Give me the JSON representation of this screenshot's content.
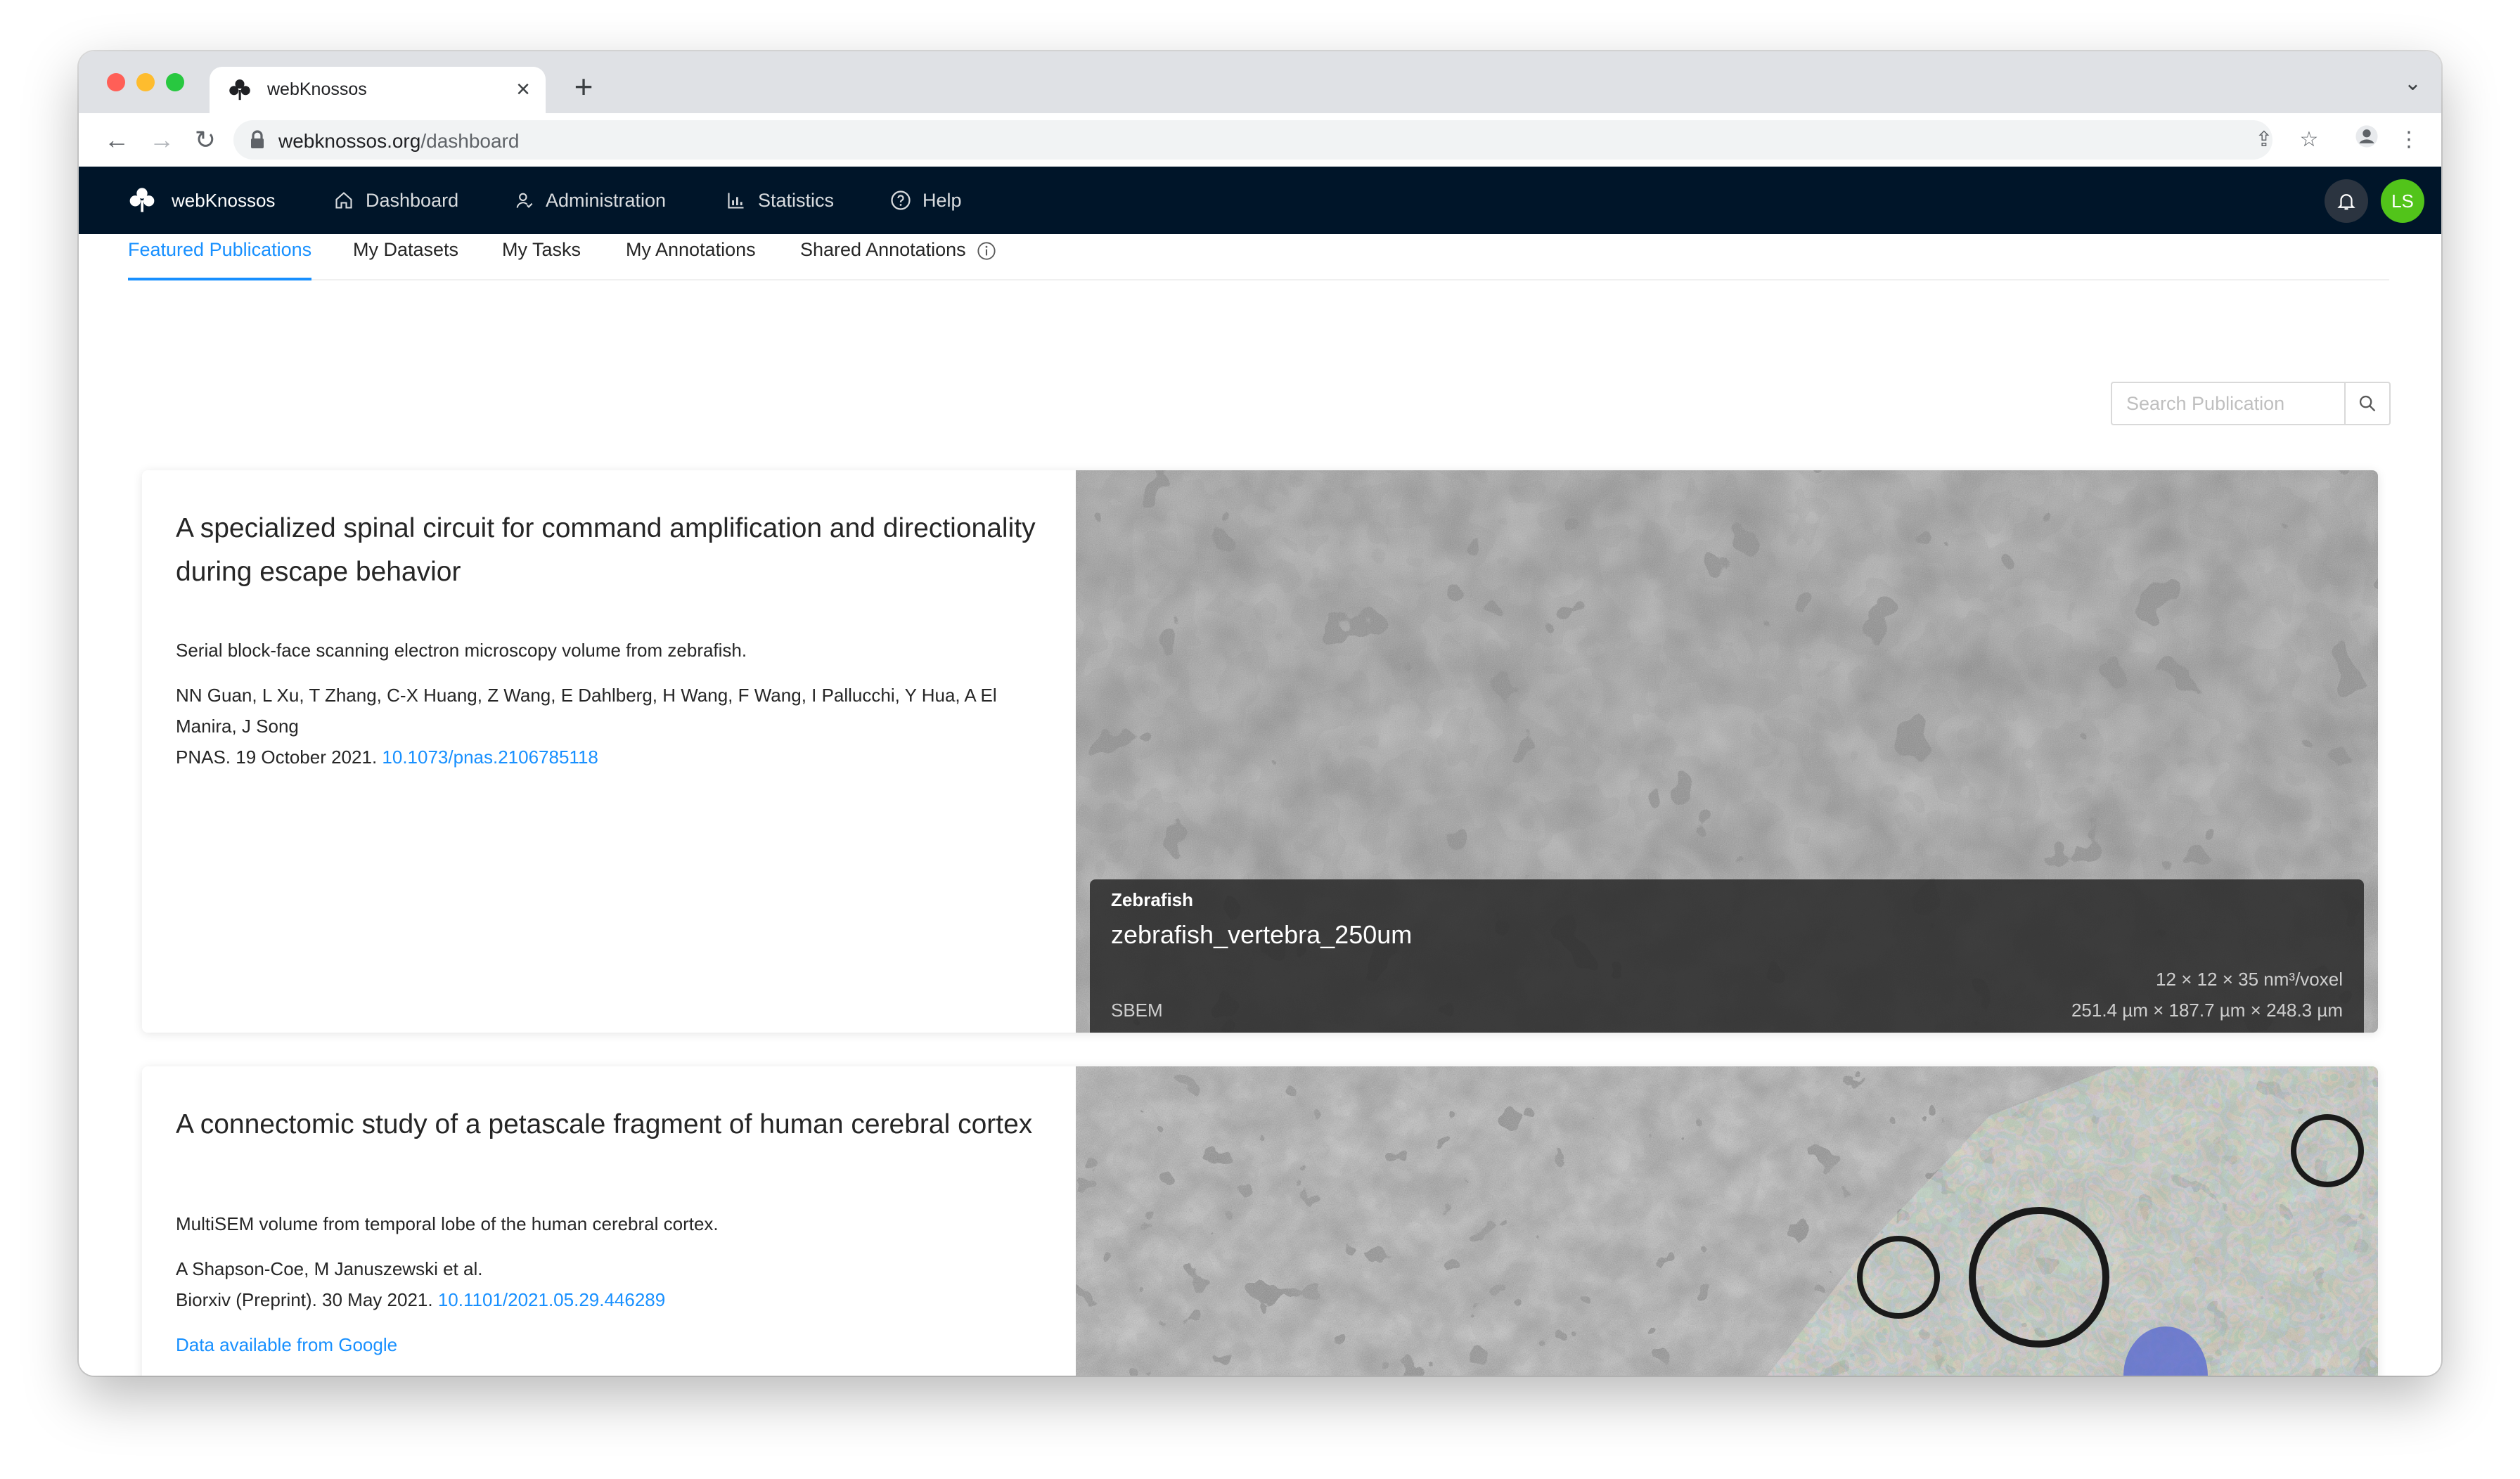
{
  "browser": {
    "tab_title": "webKnossos",
    "url_host": "webknossos.org",
    "url_path": "/dashboard"
  },
  "nav": {
    "brand": "webKnossos",
    "items": [
      {
        "label": "Dashboard",
        "icon": "home-icon"
      },
      {
        "label": "Administration",
        "icon": "user-admin-icon"
      },
      {
        "label": "Statistics",
        "icon": "bar-chart-icon"
      },
      {
        "label": "Help",
        "icon": "question-circle-icon"
      }
    ],
    "avatar_initials": "LS"
  },
  "subtabs": [
    {
      "label": "Featured Publications",
      "active": true
    },
    {
      "label": "My Datasets",
      "active": false
    },
    {
      "label": "My Tasks",
      "active": false
    },
    {
      "label": "My Annotations",
      "active": false
    },
    {
      "label": "Shared Annotations",
      "active": false
    }
  ],
  "search": {
    "placeholder": "Search Publication",
    "value": ""
  },
  "publications": [
    {
      "title": "A specialized spinal circuit for command amplification and directionality during escape behavior",
      "description": "Serial block-face scanning electron microscopy volume from zebrafish.",
      "authors": "NN Guan, L Xu, T Zhang, C-X Huang, Z Wang, E Dahlberg, H Wang, F Wang, I Pallucchi, Y Hua, A El Manira, J Song",
      "journal": "PNAS. 19 October 2021.",
      "doi": "10.1073/pnas.2106785118",
      "dataset": {
        "species": "Zebrafish",
        "name": "zebrafish_vertebra_250um",
        "technique": "SBEM",
        "voxel": "12 × 12 × 35 nm³/voxel",
        "extent": "251.4 µm × 187.7 µm × 248.3 µm"
      }
    },
    {
      "title": "A connectomic study of a petascale fragment of human cerebral cortex",
      "description": "MultiSEM volume from temporal lobe of the human cerebral cortex.",
      "authors": "A Shapson-Coe, M Januszewski et al.",
      "journal": "Biorxiv (Preprint). 30 May 2021.",
      "doi": "10.1101/2021.05.29.446289",
      "extra_link": "Data available from Google"
    }
  ]
}
